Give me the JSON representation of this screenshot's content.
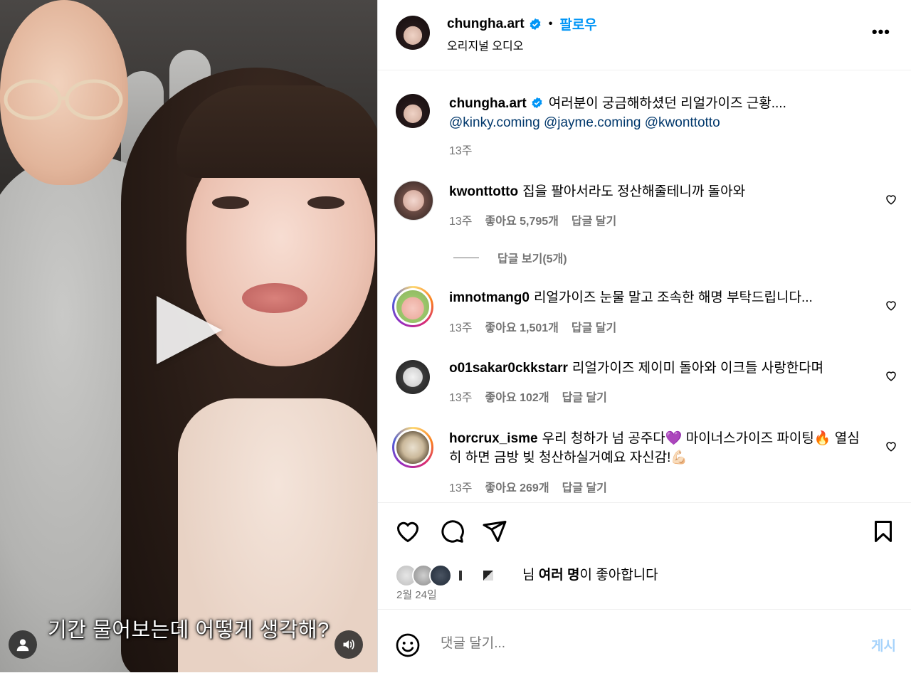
{
  "video": {
    "subtitle": "기간 물어보는데 어떻게 생각해?"
  },
  "header": {
    "username": "chungha.art",
    "follow_label": "팔로우",
    "separator": "•",
    "audio_label": "오리지널 오디오",
    "more_label": "•••"
  },
  "caption": {
    "username": "chungha.art",
    "text": "여러분이 궁금해하셨던 리얼가이즈 근황....",
    "mentions": [
      "@kinky.coming",
      "@jayme.coming",
      "@kwonttotto"
    ],
    "time": "13주"
  },
  "comments": [
    {
      "username": "kwonttotto",
      "text": "집을 팔아서라도 정산해줄테니까 돌아와",
      "time": "13주",
      "likes": "좋아요 5,795개",
      "reply": "답글 달기"
    },
    {
      "username": "imnotmang0",
      "text": "리얼가이즈 눈물 말고 조속한 해명 부탁드립니다...",
      "time": "13주",
      "likes": "좋아요 1,501개",
      "reply": "답글 달기"
    },
    {
      "username": "o01sakar0ckkstarr",
      "text": "리얼가이즈 제이미 돌아와 이크들 사랑한다며",
      "time": "13주",
      "likes": "좋아요 102개",
      "reply": "답글 달기"
    },
    {
      "username": "horcrux_isme",
      "text": "우리 청하가 넘 공주다💜 마이너스가이즈 파이팅🔥 열심히 하면 금방 빚 청산하실거예요 자신감!💪🏻",
      "time": "13주",
      "likes": "좋아요 269개",
      "reply": "답글 달기"
    }
  ],
  "view_replies": "답글 보기(5개)",
  "likes_summary": {
    "prefix": "님",
    "bold": "여러 명",
    "suffix": "이 좋아합니다"
  },
  "post_date": "2월 24일",
  "add_comment": {
    "placeholder": "댓글 달기...",
    "post_label": "게시"
  },
  "colors": {
    "link_blue": "#0095f6",
    "mention": "#00376b",
    "muted": "#737373",
    "post_disabled": "#a6d3fb"
  },
  "icons": [
    "play-icon",
    "user-icon",
    "sound-icon",
    "verified-badge-icon",
    "more-icon",
    "heart-icon",
    "comment-icon",
    "share-icon",
    "bookmark-icon",
    "emoji-icon"
  ]
}
